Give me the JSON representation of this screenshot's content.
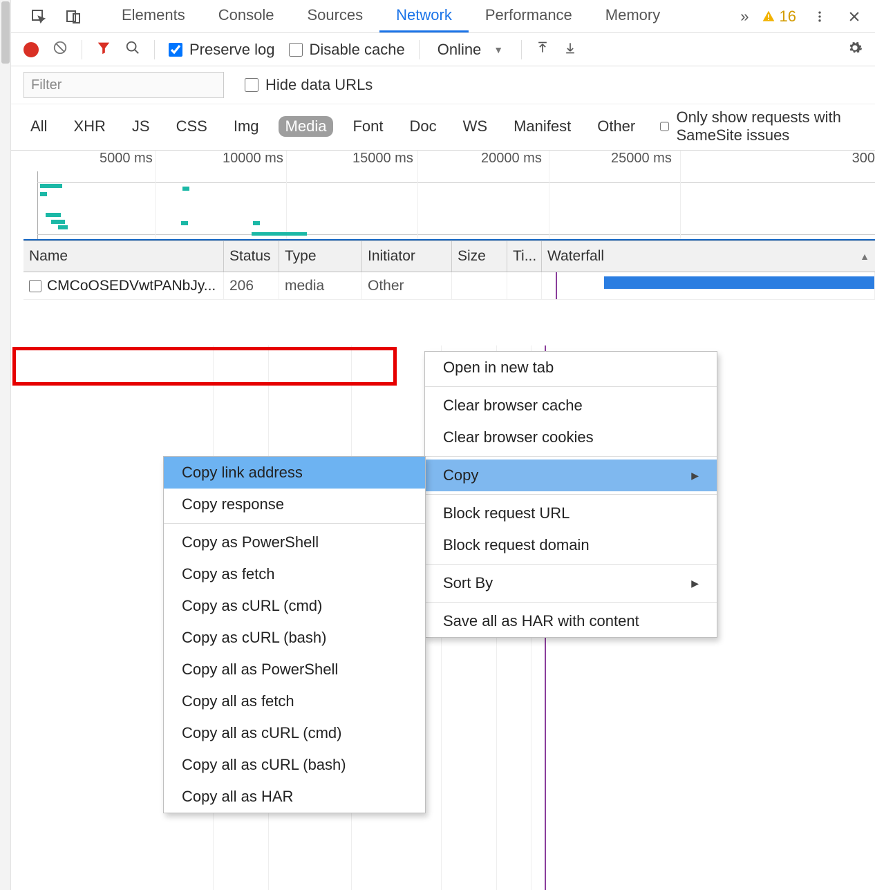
{
  "tabs": [
    "Elements",
    "Console",
    "Sources",
    "Network",
    "Performance",
    "Memory"
  ],
  "activeTab": "Network",
  "warnCount": "16",
  "toolbar": {
    "preserve": "Preserve log",
    "disableCache": "Disable cache",
    "throttle": "Online"
  },
  "filter": {
    "placeholder": "Filter",
    "hideData": "Hide data URLs",
    "types": [
      "All",
      "XHR",
      "JS",
      "CSS",
      "Img",
      "Media",
      "Font",
      "Doc",
      "WS",
      "Manifest",
      "Other"
    ],
    "activeType": "Media",
    "sameSite": "Only show requests with SameSite issues"
  },
  "timeline": {
    "ticks": [
      "5000 ms",
      "10000 ms",
      "15000 ms",
      "20000 ms",
      "25000 ms",
      "300"
    ]
  },
  "columns": [
    "Name",
    "Status",
    "Type",
    "Initiator",
    "Size",
    "Ti...",
    "Waterfall"
  ],
  "rows": [
    {
      "name": "CMCoOSEDVwtPANbJy...",
      "status": "206",
      "type": "media",
      "initiator": "Other",
      "size": "",
      "time": ""
    }
  ],
  "contextMenu": {
    "items": [
      "Open in new tab",
      "Clear browser cache",
      "Clear browser cookies",
      "Copy",
      "Block request URL",
      "Block request domain",
      "Sort By",
      "Save all as HAR with content"
    ],
    "highlighted": "Copy"
  },
  "copySubmenu": {
    "items": [
      "Copy link address",
      "Copy response",
      "Copy as PowerShell",
      "Copy as fetch",
      "Copy as cURL (cmd)",
      "Copy as cURL (bash)",
      "Copy all as PowerShell",
      "Copy all as fetch",
      "Copy all as cURL (cmd)",
      "Copy all as cURL (bash)",
      "Copy all as HAR"
    ],
    "highlighted": "Copy link address"
  }
}
